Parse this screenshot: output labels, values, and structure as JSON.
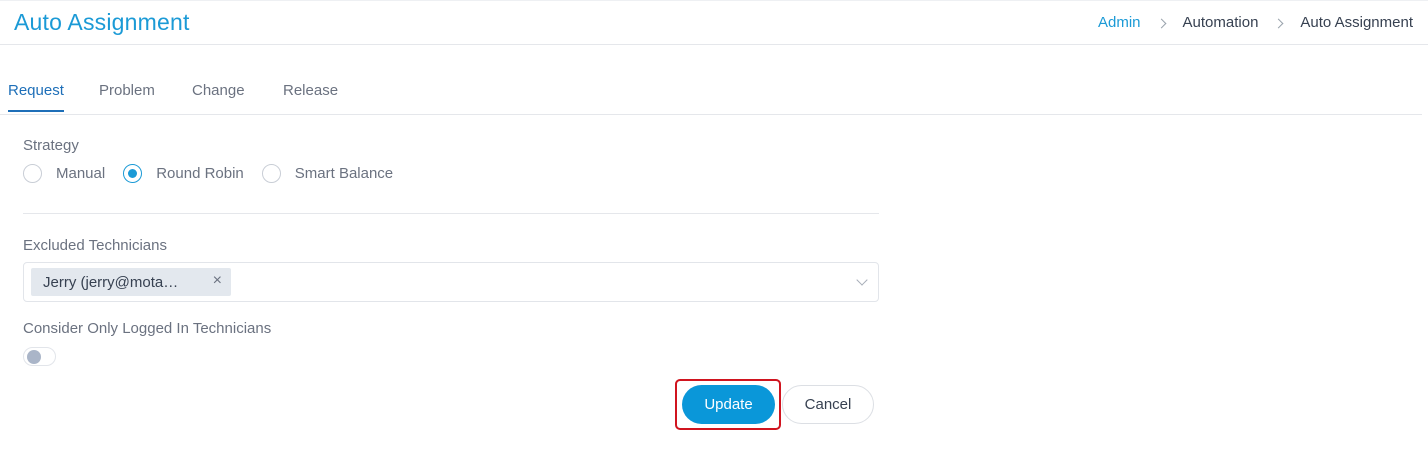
{
  "header": {
    "title": "Auto Assignment",
    "breadcrumb": [
      "Admin",
      "Automation",
      "Auto Assignment"
    ]
  },
  "tabs": [
    {
      "label": "Request",
      "active": true
    },
    {
      "label": "Problem",
      "active": false
    },
    {
      "label": "Change",
      "active": false
    },
    {
      "label": "Release",
      "active": false
    }
  ],
  "strategy": {
    "label": "Strategy",
    "options": [
      "Manual",
      "Round Robin",
      "Smart Balance"
    ],
    "selected": "Round Robin"
  },
  "excluded_technicians": {
    "label": "Excluded Technicians",
    "chips": [
      "Jerry (jerry@mota…"
    ],
    "chip_close_icon": "×"
  },
  "logged_in_only": {
    "label": "Consider Only Logged In Technicians",
    "enabled": false
  },
  "actions": {
    "update_label": "Update",
    "cancel_label": "Cancel"
  },
  "colors": {
    "accent": "#1b9ad6",
    "primary_button": "#0a97d9",
    "highlight_border": "#d0141f"
  }
}
